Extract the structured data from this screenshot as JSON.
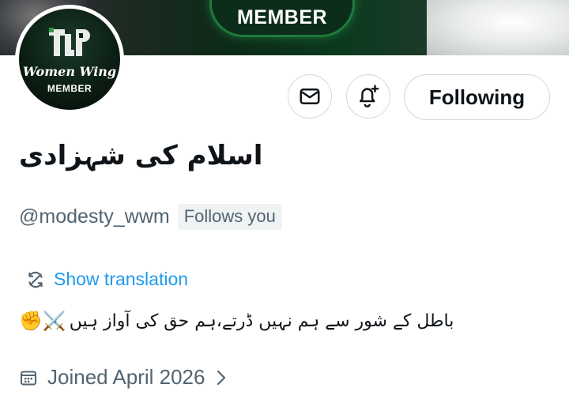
{
  "banner": {
    "badge_text": "MEMBER"
  },
  "avatar": {
    "logo_text": "TLP",
    "script_text": "Women Wing",
    "member_text": "MEMBER"
  },
  "actions": {
    "message_icon": "envelope-icon",
    "notify_icon": "bell-plus-icon",
    "follow_label": "Following"
  },
  "profile": {
    "display_name": "اسلام کی شہزادی",
    "handle": "@modesty_wwm",
    "follows_you": "Follows you",
    "translate_label": "Show translation",
    "bio_emoji": "✊⚔️",
    "bio_text": "باطل کے شور سے ہم نہیں ڈرتے،ہم حق کی آواز ہیں",
    "joined": "Joined April 2026"
  },
  "colors": {
    "link": "#1d9bf0",
    "secondary": "#536471",
    "border": "#cfd9de",
    "text": "#0f1419"
  }
}
